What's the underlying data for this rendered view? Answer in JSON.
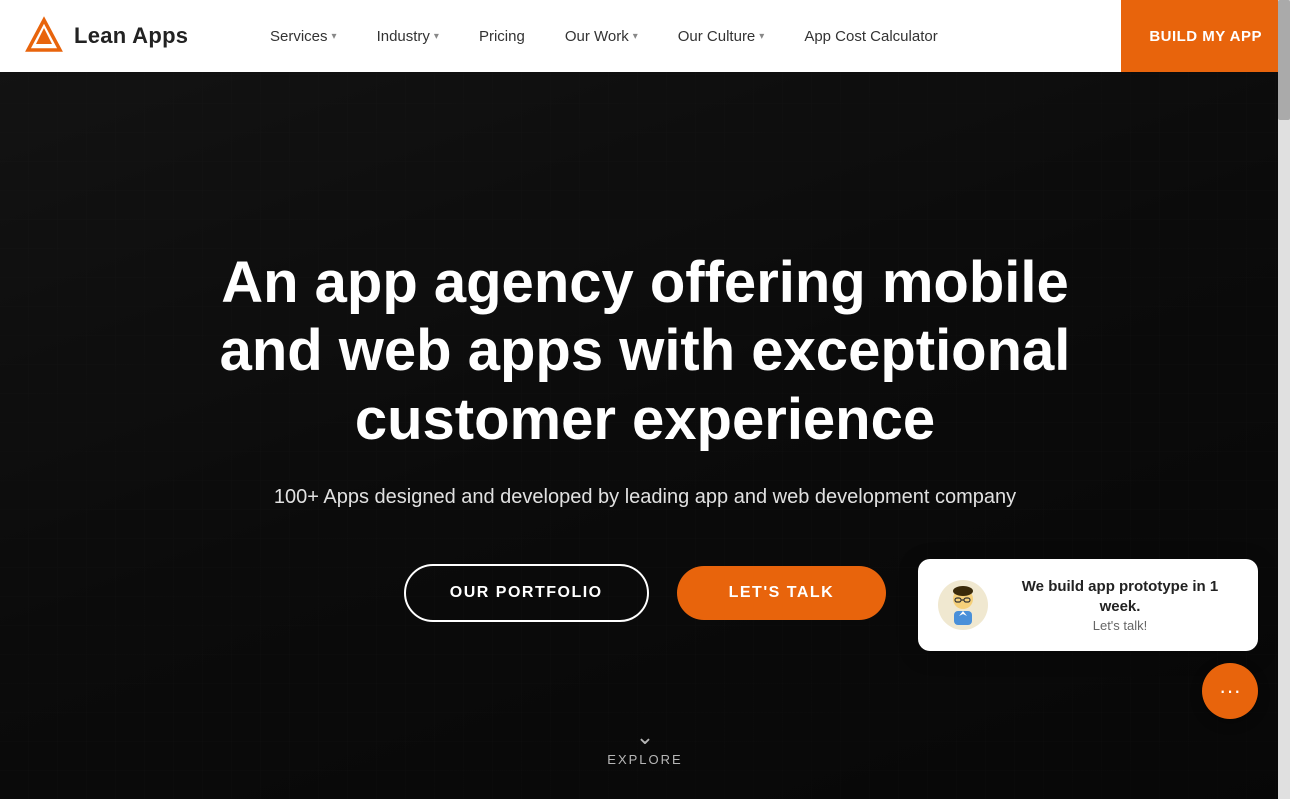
{
  "brand": {
    "name": "Lean Apps",
    "logo_alt": "Lean Apps logo"
  },
  "navbar": {
    "links": [
      {
        "id": "services",
        "label": "Services",
        "has_dropdown": true
      },
      {
        "id": "industry",
        "label": "Industry",
        "has_dropdown": true
      },
      {
        "id": "pricing",
        "label": "Pricing",
        "has_dropdown": false
      },
      {
        "id": "our-work",
        "label": "Our Work",
        "has_dropdown": true
      },
      {
        "id": "our-culture",
        "label": "Our Culture",
        "has_dropdown": true
      },
      {
        "id": "app-cost-calculator",
        "label": "App Cost Calculator",
        "has_dropdown": false
      }
    ],
    "cta_label": "BUILD MY APP"
  },
  "hero": {
    "title": "An app agency offering mobile and web apps with exceptional customer experience",
    "subtitle": "100+ Apps designed and developed by leading app and web development company",
    "btn_portfolio": "OUR PORTFOLIO",
    "btn_talk": "LET'S TALK"
  },
  "explore": {
    "label": "EXPLORE"
  },
  "chat": {
    "main_text": "We build app prototype in 1 week.",
    "sub_text": "Let's talk!",
    "avatar_emoji": "🧑‍💼"
  },
  "colors": {
    "accent": "#e8640c",
    "dark": "#1a1a1a",
    "white": "#ffffff"
  }
}
